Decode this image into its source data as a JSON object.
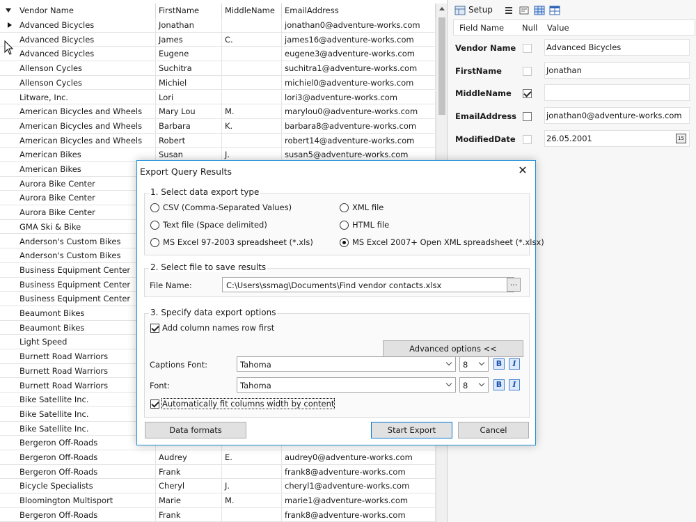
{
  "grid": {
    "columns": [
      "Vendor Name",
      "FirstName",
      "MiddleName",
      "EmailAddress"
    ],
    "rows": [
      [
        "Advanced Bicycles",
        "Jonathan",
        "",
        "jonathan0@adventure-works.com"
      ],
      [
        "Advanced Bicycles",
        "James",
        "C.",
        "james16@adventure-works.com"
      ],
      [
        "Advanced Bicycles",
        "Eugene",
        "",
        "eugene3@adventure-works.com"
      ],
      [
        "Allenson Cycles",
        "Suchitra",
        "",
        "suchitra1@adventure-works.com"
      ],
      [
        "Allenson Cycles",
        "Michiel",
        "",
        "michiel0@adventure-works.com"
      ],
      [
        "Litware, Inc.",
        "Lori",
        "",
        "lori3@adventure-works.com"
      ],
      [
        "American Bicycles and Wheels",
        "Mary Lou",
        "M.",
        "marylou0@adventure-works.com"
      ],
      [
        "American Bicycles and Wheels",
        "Barbara",
        "K.",
        "barbara8@adventure-works.com"
      ],
      [
        "American Bicycles and Wheels",
        "Robert",
        "",
        "robert14@adventure-works.com"
      ],
      [
        "American Bikes",
        "Susan",
        "J.",
        "susan5@adventure-works.com"
      ],
      [
        "American Bikes",
        "",
        "",
        ""
      ],
      [
        "Aurora Bike Center",
        "",
        "",
        ""
      ],
      [
        "Aurora Bike Center",
        "",
        "",
        ""
      ],
      [
        "Aurora Bike Center",
        "",
        "",
        ""
      ],
      [
        "GMA Ski & Bike",
        "",
        "",
        ""
      ],
      [
        "Anderson's Custom Bikes",
        "",
        "",
        ""
      ],
      [
        "Anderson's Custom Bikes",
        "",
        "",
        ""
      ],
      [
        "Business Equipment Center",
        "",
        "",
        ""
      ],
      [
        "Business Equipment Center",
        "",
        "",
        ""
      ],
      [
        "Business Equipment Center",
        "",
        "",
        ""
      ],
      [
        "Beaumont Bikes",
        "",
        "",
        ""
      ],
      [
        "Beaumont Bikes",
        "",
        "",
        ""
      ],
      [
        "Light Speed",
        "",
        "",
        ""
      ],
      [
        "Burnett Road Warriors",
        "",
        "",
        ""
      ],
      [
        "Burnett Road Warriors",
        "",
        "",
        ""
      ],
      [
        "Burnett Road Warriors",
        "",
        "",
        ""
      ],
      [
        "Bike Satellite Inc.",
        "",
        "",
        ""
      ],
      [
        "Bike Satellite Inc.",
        "",
        "",
        ""
      ],
      [
        "Bike Satellite Inc.",
        "",
        "",
        ""
      ],
      [
        "Bergeron Off-Roads",
        "",
        "",
        ""
      ],
      [
        "Bergeron Off-Roads",
        "Audrey",
        "E.",
        "audrey0@adventure-works.com"
      ],
      [
        "Bergeron Off-Roads",
        "Frank",
        "",
        "frank8@adventure-works.com"
      ],
      [
        "Bicycle Specialists",
        "Cheryl",
        "J.",
        "cheryl1@adventure-works.com"
      ],
      [
        "Bloomington Multisport",
        "Marie",
        "M.",
        "marie1@adventure-works.com"
      ],
      [
        "Bergeron Off-Roads",
        "Frank",
        "",
        "frank8@adventure-works.com"
      ]
    ]
  },
  "panel": {
    "setup_label": "Setup",
    "headers": {
      "field": "Field Name",
      "null": "Null",
      "value": "Value"
    },
    "fields": [
      {
        "name": "Vendor Name",
        "null_checked": false,
        "null_enabled": false,
        "value": "Advanced Bicycles"
      },
      {
        "name": "FirstName",
        "null_checked": false,
        "null_enabled": false,
        "value": "Jonathan"
      },
      {
        "name": "MiddleName",
        "null_checked": true,
        "null_enabled": true,
        "value": ""
      },
      {
        "name": "EmailAddress",
        "null_checked": false,
        "null_enabled": true,
        "value": "jonathan0@adventure-works.com"
      },
      {
        "name": "ModifiedDate",
        "null_checked": false,
        "null_enabled": false,
        "value": "26.05.2001"
      }
    ],
    "calendar_icon": "15"
  },
  "dialog": {
    "title": "Export Query Results",
    "close_glyph": "✕",
    "section1": "1. Select data export type",
    "formats": [
      {
        "label": "CSV (Comma-Separated Values)",
        "checked": false
      },
      {
        "label": "XML file",
        "checked": false
      },
      {
        "label": "Text file (Space delimited)",
        "checked": false
      },
      {
        "label": "HTML file",
        "checked": false
      },
      {
        "label": "MS Excel 97-2003 spreadsheet (*.xls)",
        "checked": false
      },
      {
        "label": "MS Excel 2007+ Open XML spreadsheet (*.xlsx)",
        "checked": true
      }
    ],
    "section2": "2. Select file to save results",
    "file_label": "File Name:",
    "file_value": "C:\\Users\\ssmag\\Documents\\Find vendor contacts.xlsx",
    "browse_label": "...",
    "section3": "3. Specify data export options",
    "add_columns_label": "Add column names row first",
    "add_columns_checked": true,
    "advanced_label": "Advanced options <<",
    "captions_font_label": "Captions Font:",
    "captions_font": "Tahoma",
    "captions_size": "8",
    "font_label": "Font:",
    "font": "Tahoma",
    "font_size": "8",
    "bold_glyph": "B",
    "italic_glyph": "I",
    "autofit_label": "Automatically fit columns width by content",
    "autofit_checked": true,
    "data_formats_label": "Data formats",
    "start_label": "Start Export",
    "cancel_label": "Cancel"
  }
}
